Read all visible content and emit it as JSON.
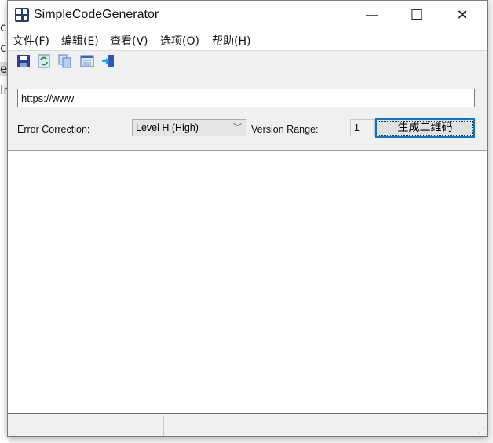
{
  "background_window": {
    "fragments": [
      "c",
      "c",
      "e",
      "In"
    ]
  },
  "window": {
    "title": "SimpleCodeGenerator",
    "controls": {
      "minimize": "—",
      "maximize": "☐",
      "close": "✕"
    }
  },
  "menu": [
    {
      "label": "文件(F)"
    },
    {
      "label": "编辑(E)"
    },
    {
      "label": "查看(V)"
    },
    {
      "label": "选项(O)"
    },
    {
      "label": "帮助(H)"
    }
  ],
  "toolbar": [
    "save-icon",
    "refresh-icon",
    "copy-icon",
    "window-icon",
    "exit-icon"
  ],
  "form": {
    "url_value": "https://www",
    "error_correction_label": "Error Correction:",
    "error_correction_value": "Level H (High)",
    "version_range_label": "Version Range:",
    "version_value": "1",
    "generate_label": "生成二维码"
  }
}
